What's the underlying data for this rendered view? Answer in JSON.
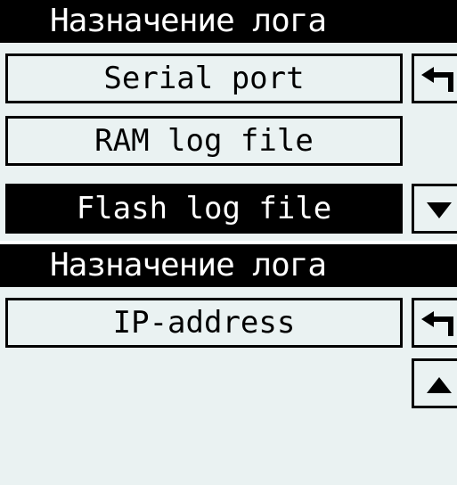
{
  "screens": [
    {
      "title": "Назначение лога",
      "items": [
        {
          "label": "Serial port",
          "selected": false
        },
        {
          "label": "RAM log file",
          "selected": false
        },
        {
          "label": "Flash log file",
          "selected": true
        }
      ],
      "nav": {
        "back_icon": "back-arrow-icon",
        "scroll_icon": "arrow-down-icon"
      }
    },
    {
      "title": "Назначение лога",
      "items": [
        {
          "label": "IP-address",
          "selected": false
        }
      ],
      "nav": {
        "back_icon": "back-arrow-icon",
        "scroll_icon": "arrow-up-icon"
      }
    }
  ],
  "colors": {
    "background": "#eaf2f2",
    "foreground": "#000000",
    "inverse_text": "#ffffff"
  }
}
